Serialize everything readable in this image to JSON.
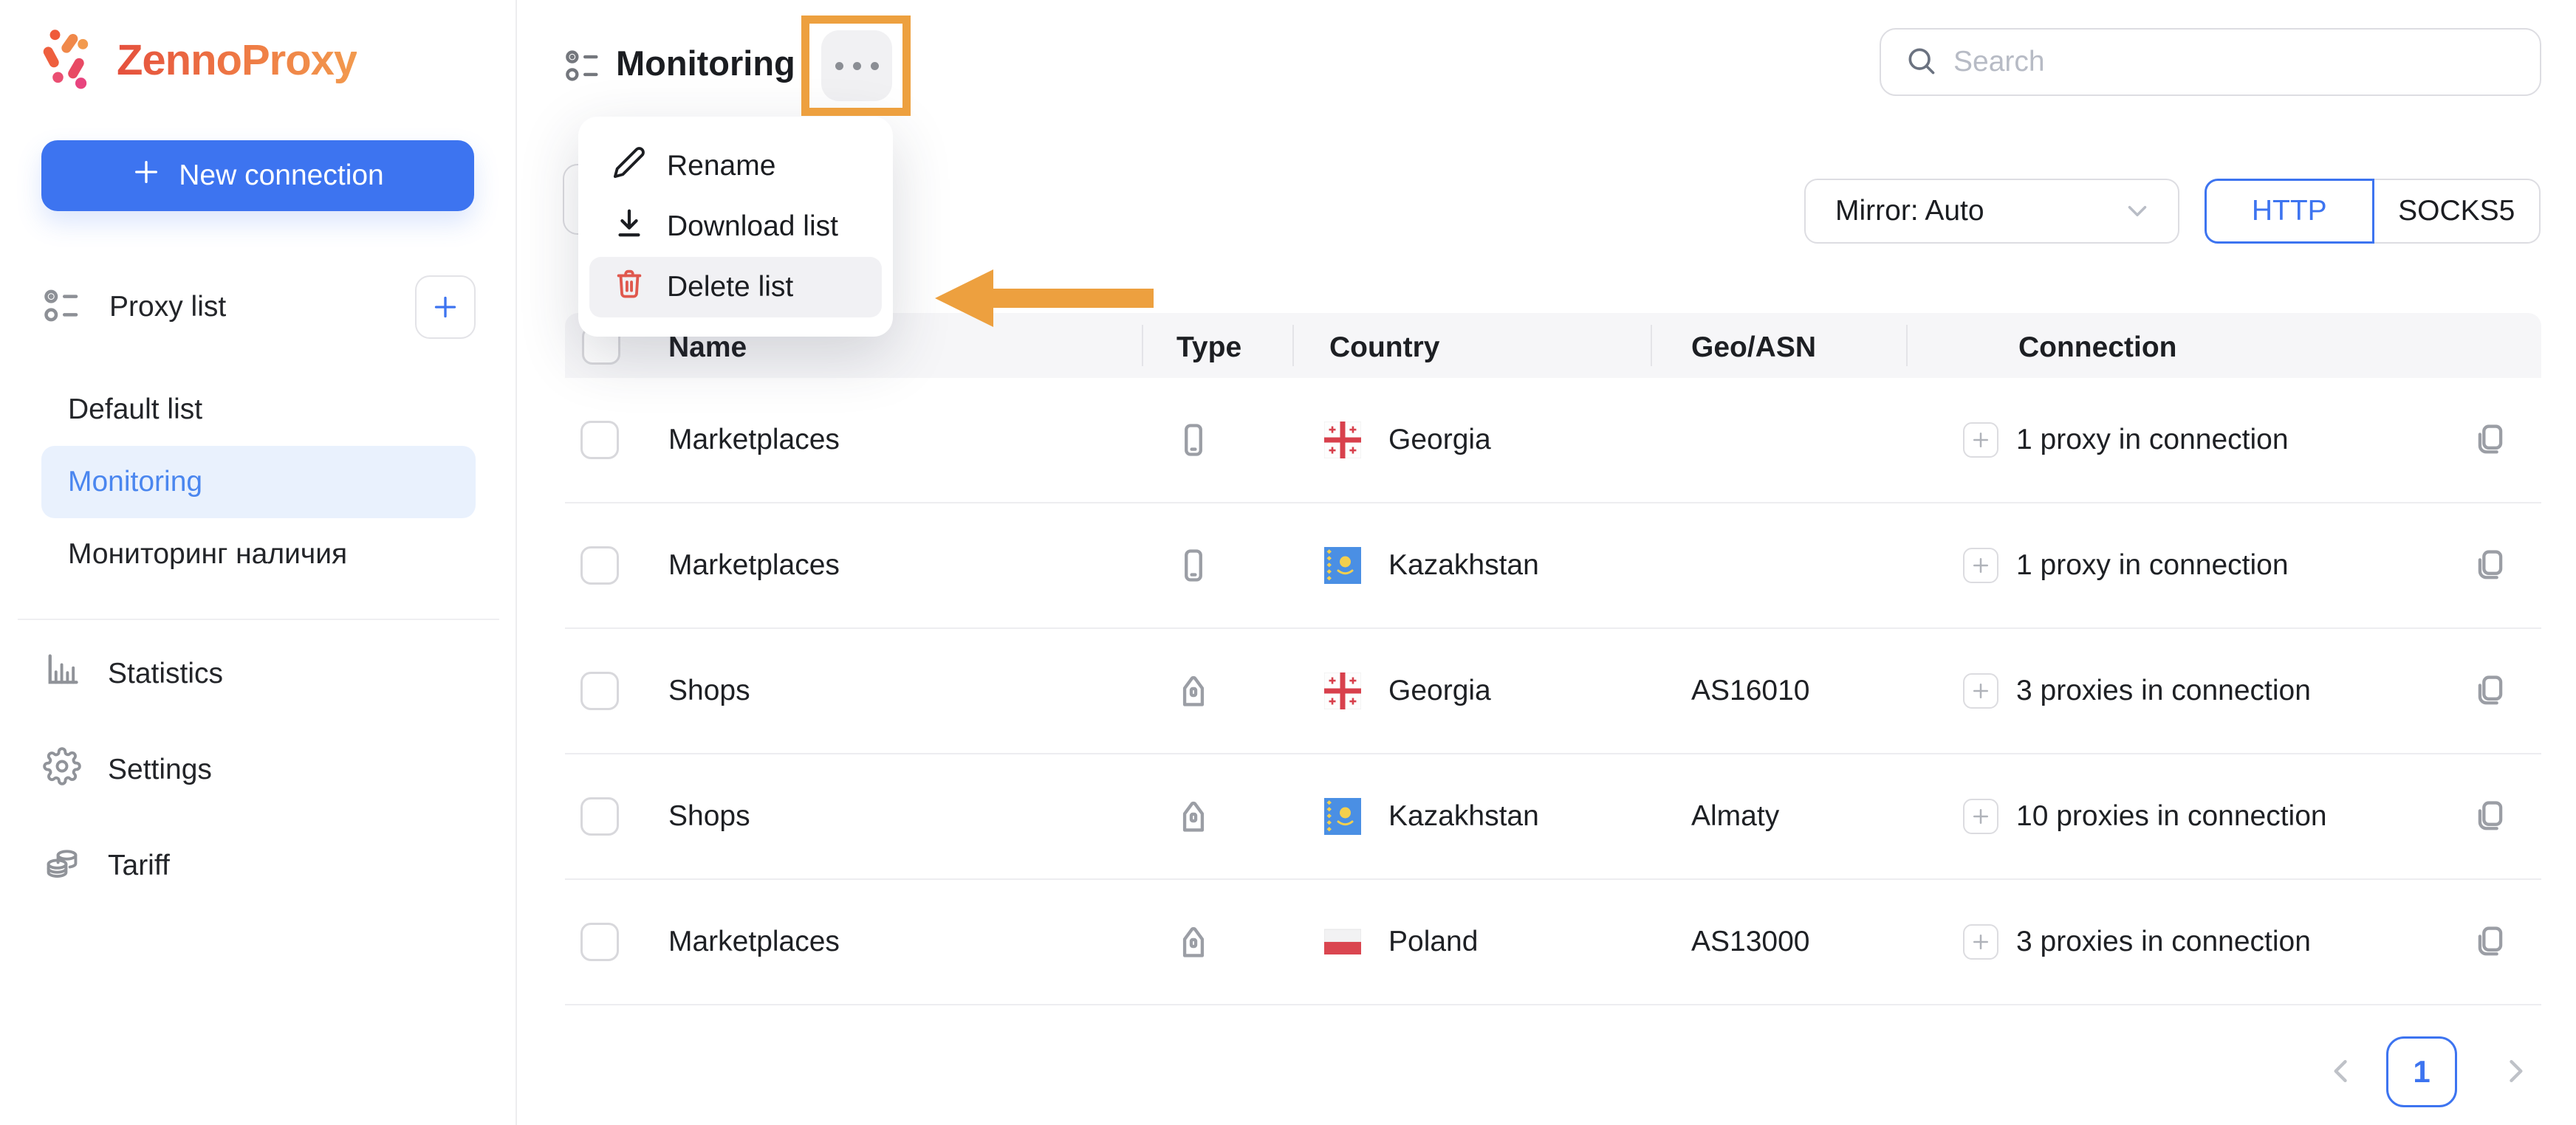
{
  "app": {
    "brand": "ZennoProxy"
  },
  "sidebar": {
    "new_connection_label": "New connection",
    "section_label": "Proxy list",
    "lists": [
      {
        "label": "Default list",
        "active": false
      },
      {
        "label": "Monitoring",
        "active": true
      },
      {
        "label": "Мониторинг наличия",
        "active": false
      }
    ],
    "nav": [
      {
        "label": "Statistics",
        "icon": "statistics-icon"
      },
      {
        "label": "Settings",
        "icon": "settings-icon"
      },
      {
        "label": "Tariff",
        "icon": "tariff-icon"
      }
    ]
  },
  "header": {
    "title": "Monitoring"
  },
  "search": {
    "placeholder": "Search"
  },
  "controls": {
    "mirror_label": "Mirror: Auto",
    "protocols": [
      {
        "label": "HTTP",
        "active": true
      },
      {
        "label": "SOCKS5",
        "active": false
      }
    ]
  },
  "menu": {
    "items": [
      {
        "label": "Rename",
        "icon": "pencil-icon",
        "highlighted": false
      },
      {
        "label": "Download list",
        "icon": "download-icon",
        "highlighted": false
      },
      {
        "label": "Delete list",
        "icon": "trash-icon",
        "highlighted": true
      }
    ]
  },
  "table": {
    "columns": [
      "Name",
      "Type",
      "Country",
      "Geo/ASN",
      "Connection"
    ],
    "rows": [
      {
        "name": "Marketplaces",
        "type": "phone",
        "country": "Georgia",
        "flag": "ge",
        "geo": "",
        "connection": "1 proxy in connection"
      },
      {
        "name": "Marketplaces",
        "type": "phone",
        "country": "Kazakhstan",
        "flag": "kz",
        "geo": "",
        "connection": "1 proxy in connection"
      },
      {
        "name": "Shops",
        "type": "home",
        "country": "Georgia",
        "flag": "ge",
        "geo": "AS16010",
        "connection": "3 proxies in connection"
      },
      {
        "name": "Shops",
        "type": "home",
        "country": "Kazakhstan",
        "flag": "kz",
        "geo": "Almaty",
        "connection": "10 proxies in connection"
      },
      {
        "name": "Marketplaces",
        "type": "home",
        "country": "Poland",
        "flag": "pl",
        "geo": "AS13000",
        "connection": "3 proxies in connection"
      }
    ]
  },
  "pagination": {
    "current": "1"
  },
  "colors": {
    "accent_blue": "#3d74f0",
    "active_item_bg": "#e9f1fd",
    "annotation_orange": "#eda03f",
    "danger_red": "#e0584e",
    "table_header_bg": "#f6f6f8"
  }
}
